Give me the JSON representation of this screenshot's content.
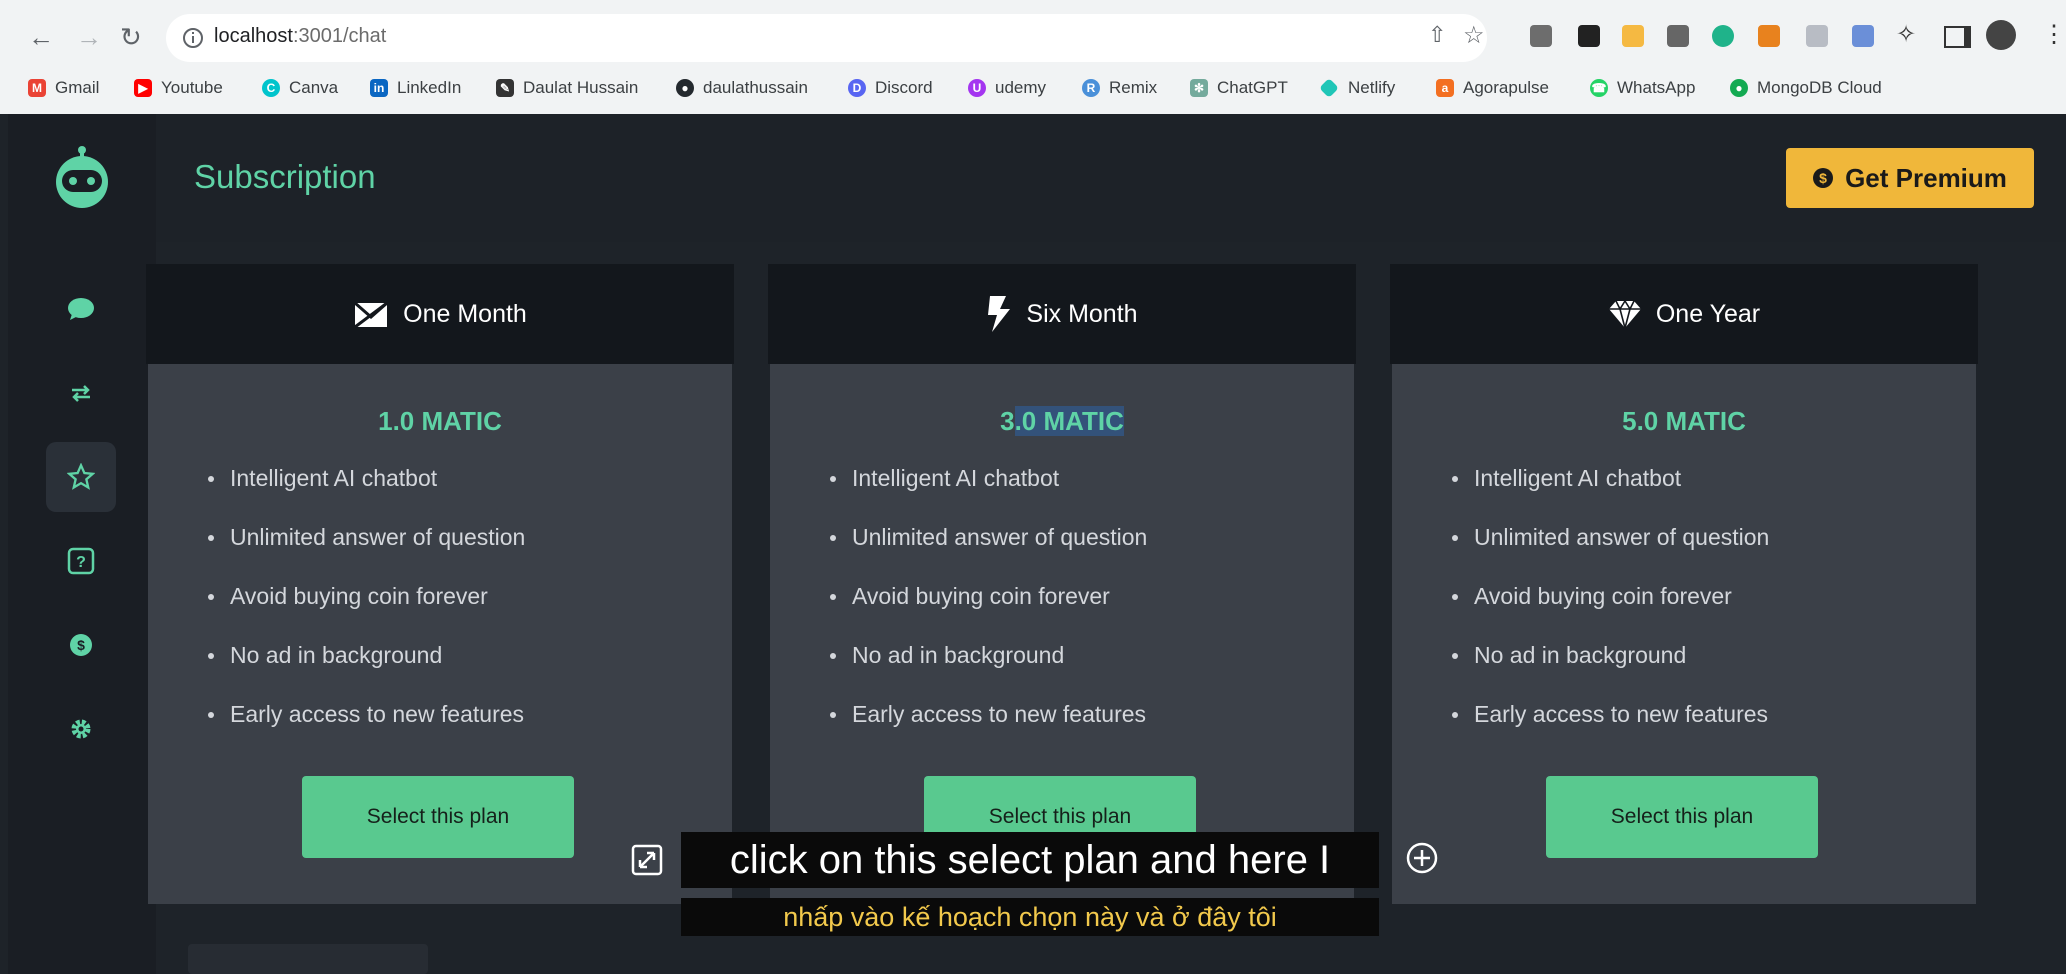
{
  "browser": {
    "url_host": "localhost",
    "url_path": ":3001/chat",
    "bookmarks": [
      {
        "label": "Gmail",
        "icon": "gmail-icon",
        "color": "#ea4335"
      },
      {
        "label": "Youtube",
        "icon": "youtube-icon",
        "color": "#ff0000"
      },
      {
        "label": "Canva",
        "icon": "canva-icon",
        "color": "#00c4cc"
      },
      {
        "label": "LinkedIn",
        "icon": "linkedin-icon",
        "color": "#0a66c2"
      },
      {
        "label": "Daulat Hussain",
        "icon": "brush-icon",
        "color": "#333333"
      },
      {
        "label": "daulathussain",
        "icon": "github-icon",
        "color": "#24292e"
      },
      {
        "label": "Discord",
        "icon": "discord-icon",
        "color": "#5865f2"
      },
      {
        "label": "udemy",
        "icon": "udemy-icon",
        "color": "#a435f0"
      },
      {
        "label": "Remix",
        "icon": "remix-icon",
        "color": "#4a90d9"
      },
      {
        "label": "ChatGPT",
        "icon": "chatgpt-icon",
        "color": "#74aa9c"
      },
      {
        "label": "Netlify",
        "icon": "netlify-icon",
        "color": "#20c6b7"
      },
      {
        "label": "Agorapulse",
        "icon": "agorapulse-icon",
        "color": "#f36f21"
      },
      {
        "label": "WhatsApp",
        "icon": "whatsapp-icon",
        "color": "#25d366"
      },
      {
        "label": "MongoDB Cloud",
        "icon": "mongodb-icon",
        "color": "#13aa52"
      }
    ]
  },
  "header": {
    "title": "Subscription",
    "premium_label": "Get Premium"
  },
  "plans": [
    {
      "name": "One Month",
      "icon": "envelope-icon",
      "price": "1.0 MATIC",
      "features": [
        "Intelligent AI chatbot",
        "Unlimited answer of question",
        "Avoid buying coin forever",
        "No ad in background",
        "Early access to new features"
      ],
      "button": "Select this plan"
    },
    {
      "name": "Six Month",
      "icon": "lightning-icon",
      "price_prefix": "3",
      "price_highlight": ".0 MATIC",
      "features": [
        "Intelligent AI chatbot",
        "Unlimited answer of question",
        "Avoid buying coin forever",
        "No ad in background",
        "Early access to new features"
      ],
      "button": "Select this plan"
    },
    {
      "name": "One Year",
      "icon": "diamond-icon",
      "price": "5.0 MATIC",
      "features": [
        "Intelligent AI chatbot",
        "Unlimited answer of question",
        "Avoid buying coin forever",
        "No ad in background",
        "Early access to new features"
      ],
      "button": "Select this plan"
    }
  ],
  "sidebar": {
    "items": [
      {
        "icon": "chat-icon"
      },
      {
        "icon": "swap-icon"
      },
      {
        "icon": "star-icon",
        "active": true
      },
      {
        "icon": "help-icon"
      },
      {
        "icon": "dollar-icon"
      },
      {
        "icon": "gear-icon"
      }
    ]
  },
  "captions": {
    "line1": "click on this select plan and here I",
    "line2": "nhấp vào kế hoạch chọn này và ở đây tôi"
  },
  "colors": {
    "accent": "#5fd3a6",
    "button": "#59c98f",
    "premium": "#f0b73a",
    "background": "#1e2329"
  }
}
